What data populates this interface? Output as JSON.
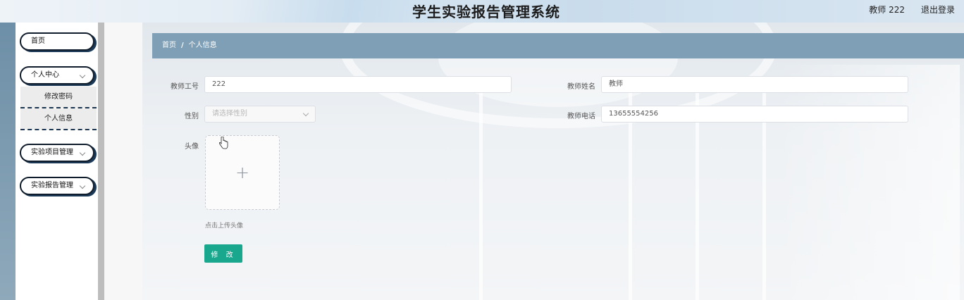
{
  "header": {
    "title": "学生实验报告管理系统",
    "user": "教师 222",
    "logout": "退出登录"
  },
  "sidebar": {
    "items": [
      {
        "label": "首页"
      },
      {
        "label": "个人中心",
        "expanded": true,
        "children": [
          {
            "label": "修改密码"
          },
          {
            "label": "个人信息"
          }
        ]
      },
      {
        "label": "实验项目管理"
      },
      {
        "label": "实验报告管理"
      }
    ]
  },
  "breadcrumb": {
    "home": "首页",
    "separator": "/",
    "current": "个人信息"
  },
  "form": {
    "teacher_id": {
      "label": "教师工号",
      "value": "222"
    },
    "teacher_name": {
      "label": "教师姓名",
      "value": "教师"
    },
    "gender": {
      "label": "性别",
      "placeholder": "请选择性别"
    },
    "teacher_phone": {
      "label": "教师电话",
      "value": "13655554256"
    },
    "avatar": {
      "label": "头像",
      "tip": "点击上传头像",
      "icon": "plus-icon"
    },
    "submit": "修 改"
  },
  "colors": {
    "breadcrumb_bg": "#7e9fb5",
    "primary_button": "#19a78e",
    "menu_border": "#0f1c2b"
  }
}
